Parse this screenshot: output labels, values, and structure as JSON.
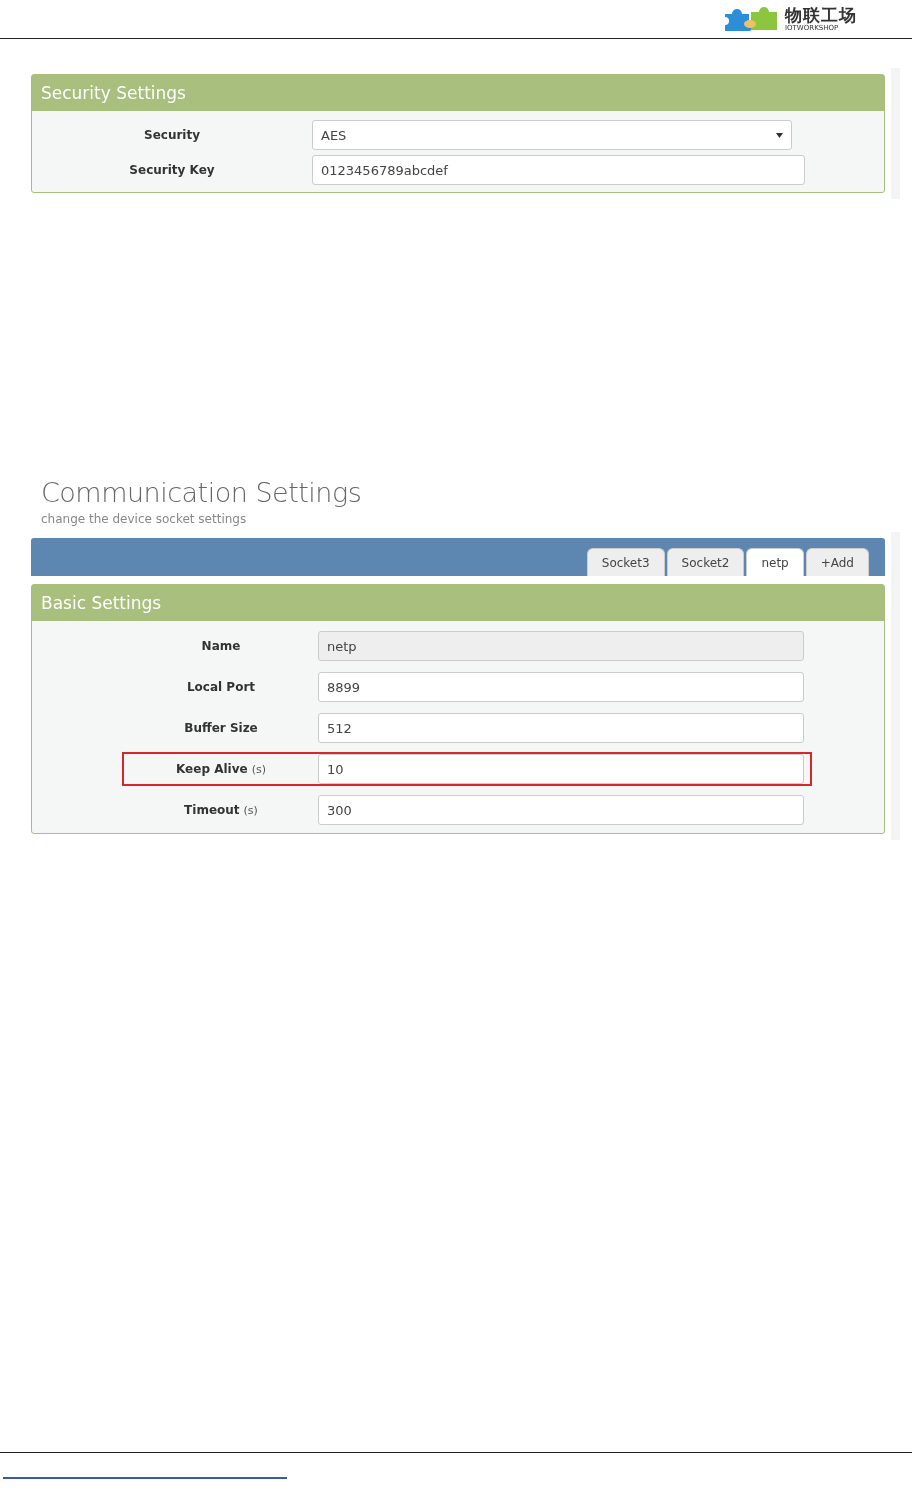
{
  "header": {
    "logo_text": "物联工场",
    "logo_subtext": "IOTWORKSHOP"
  },
  "security_panel": {
    "title": "Security Settings",
    "fields": [
      {
        "kind": "select",
        "label": "Security",
        "value": "AES"
      },
      {
        "kind": "input",
        "label": "Security Key",
        "value": "0123456789abcdef"
      }
    ]
  },
  "communication": {
    "title": "Communication Settings",
    "subtitle": "change the device socket settings",
    "tabs": [
      {
        "label": "Socket3",
        "selected": false
      },
      {
        "label": "Socket2",
        "selected": false
      },
      {
        "label": "netp",
        "selected": true
      },
      {
        "label": "+Add",
        "selected": false
      }
    ],
    "panel_title": "Basic Settings",
    "fields": [
      {
        "label": "Name",
        "value": "netp",
        "disabled": true,
        "highlighted": false
      },
      {
        "label": "Local Port",
        "value": "8899",
        "disabled": false,
        "highlighted": false
      },
      {
        "label": "Buffer Size",
        "value": "512",
        "disabled": false,
        "highlighted": false
      },
      {
        "label": "Keep Alive",
        "unit": "(s)",
        "value": "10",
        "disabled": false,
        "highlighted": true
      },
      {
        "label": "Timeout",
        "unit": "(s)",
        "value": "300",
        "disabled": false,
        "highlighted": false
      }
    ]
  }
}
